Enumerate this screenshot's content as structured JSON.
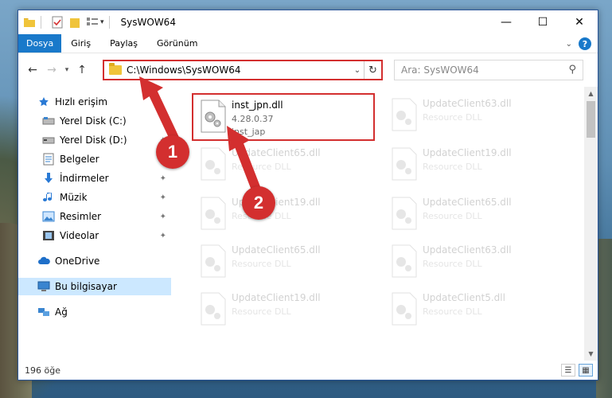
{
  "window": {
    "title": "SysWOW64",
    "controls": {
      "minimize": "—",
      "maximize": "☐",
      "close": "✕"
    }
  },
  "ribbon": {
    "tabs": [
      {
        "label": "Dosya",
        "active": true
      },
      {
        "label": "Giriş",
        "active": false
      },
      {
        "label": "Paylaş",
        "active": false
      },
      {
        "label": "Görünüm",
        "active": false
      }
    ],
    "help": "?"
  },
  "address": {
    "path": "C:\\Windows\\SysWOW64",
    "search_placeholder": "Ara: SysWOW64"
  },
  "sidebar": {
    "items": [
      {
        "label": "Hızlı erişim",
        "icon": "star-icon"
      },
      {
        "label": "Yerel Disk (C:)",
        "icon": "drive-icon",
        "pinned": true
      },
      {
        "label": "Yerel Disk (D:)",
        "icon": "drive-icon",
        "pinned": true
      },
      {
        "label": "Belgeler",
        "icon": "documents-icon",
        "pinned": true
      },
      {
        "label": "İndirmeler",
        "icon": "download-icon",
        "pinned": true
      },
      {
        "label": "Müzik",
        "icon": "music-icon",
        "pinned": true
      },
      {
        "label": "Resimler",
        "icon": "pictures-icon",
        "pinned": true
      },
      {
        "label": "Videolar",
        "icon": "video-icon",
        "pinned": true
      },
      {
        "label": "OneDrive",
        "icon": "cloud-icon"
      },
      {
        "label": "Bu bilgisayar",
        "icon": "computer-icon",
        "selected": true
      },
      {
        "label": "Ağ",
        "icon": "network-icon"
      }
    ]
  },
  "files": [
    {
      "name": "inst_jpn.dll",
      "line1": "4.28.0.37",
      "line2": "inst_jap",
      "highlight": true
    },
    {
      "name": "UpdateClient63.dll",
      "line1": "Resource DLL",
      "line2": ""
    },
    {
      "name": "UpdateClient65.dll",
      "line1": "Resource DLL",
      "line2": ""
    },
    {
      "name": "UpdateClient19.dll",
      "line1": "Resource DLL",
      "line2": ""
    },
    {
      "name": "UpdateClient19.dll",
      "line1": "Resource DLL",
      "line2": ""
    },
    {
      "name": "UpdateClient65.dll",
      "line1": "Resource DLL",
      "line2": ""
    },
    {
      "name": "UpdateClient65.dll",
      "line1": "Resource DLL",
      "line2": ""
    },
    {
      "name": "UpdateClient63.dll",
      "line1": "Resource DLL",
      "line2": ""
    },
    {
      "name": "UpdateClient19.dll",
      "line1": "Resource DLL",
      "line2": ""
    },
    {
      "name": "UpdateClient5.dll",
      "line1": "Resource DLL",
      "line2": ""
    }
  ],
  "status": {
    "count": "196 öğe"
  },
  "annotations": {
    "step1": "1",
    "step2": "2",
    "color": "#d32f2f"
  }
}
